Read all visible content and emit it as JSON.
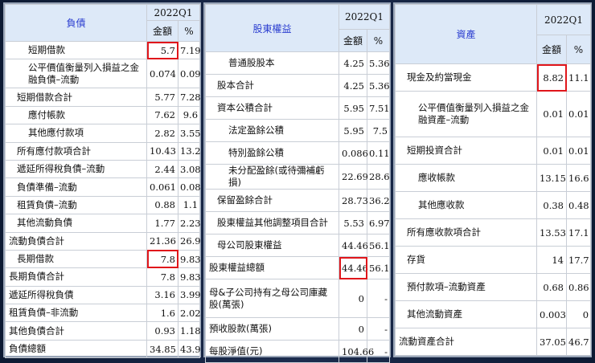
{
  "panels": [
    {
      "title": "負債",
      "period": "2022Q1",
      "amount_header": "金額",
      "pct_header": "%",
      "rows": [
        {
          "label": "短期借款",
          "amount": "5.7",
          "pct": "7.19",
          "level": 2,
          "highlight": true
        },
        {
          "label": "公平價值衡量列入損益之金融負債–流動",
          "amount": "0.074",
          "pct": "0.09",
          "level": 2
        },
        {
          "label": "短期借款合計",
          "amount": "5.77",
          "pct": "7.28",
          "level": 1
        },
        {
          "label": "應付帳款",
          "amount": "7.62",
          "pct": "9.6",
          "level": 2
        },
        {
          "label": "其他應付款項",
          "amount": "2.82",
          "pct": "3.55",
          "level": 2
        },
        {
          "label": "所有應付款項合計",
          "amount": "10.43",
          "pct": "13.2",
          "level": 1
        },
        {
          "label": "遞延所得稅負債–流動",
          "amount": "2.44",
          "pct": "3.08",
          "level": 1
        },
        {
          "label": "負債準備–流動",
          "amount": "0.061",
          "pct": "0.08",
          "level": 1
        },
        {
          "label": "租賃負債–流動",
          "amount": "0.88",
          "pct": "1.1",
          "level": 1
        },
        {
          "label": "其他流動負債",
          "amount": "1.77",
          "pct": "2.23",
          "level": 1
        },
        {
          "label": "流動負債合計",
          "amount": "21.36",
          "pct": "26.9",
          "level": 0
        },
        {
          "label": "長期借款",
          "amount": "7.8",
          "pct": "9.83",
          "level": 1,
          "highlight": true
        },
        {
          "label": "長期負債合計",
          "amount": "7.8",
          "pct": "9.83",
          "level": 0
        },
        {
          "label": "遞延所得稅負債",
          "amount": "3.16",
          "pct": "3.99",
          "level": 0
        },
        {
          "label": "租賃負債–非流動",
          "amount": "1.6",
          "pct": "2.02",
          "level": 0
        },
        {
          "label": "其他負債合計",
          "amount": "0.93",
          "pct": "1.18",
          "level": 0
        },
        {
          "label": "負債總額",
          "amount": "34.85",
          "pct": "43.9",
          "level": -1
        }
      ]
    },
    {
      "title": "股東權益",
      "period": "2022Q1",
      "amount_header": "金額",
      "pct_header": "%",
      "rows": [
        {
          "label": "普通股股本",
          "amount": "4.25",
          "pct": "5.36",
          "level": 2
        },
        {
          "label": "股本合計",
          "amount": "4.25",
          "pct": "5.36",
          "level": 1
        },
        {
          "label": "資本公積合計",
          "amount": "5.95",
          "pct": "7.51",
          "level": 1
        },
        {
          "label": "法定盈餘公積",
          "amount": "5.95",
          "pct": "7.5",
          "level": 2
        },
        {
          "label": "特別盈餘公積",
          "amount": "0.086",
          "pct": "0.11",
          "level": 2
        },
        {
          "label": "未分配盈餘(或待彌補虧損)",
          "amount": "22.69",
          "pct": "28.6",
          "level": 2
        },
        {
          "label": "保留盈餘合計",
          "amount": "28.73",
          "pct": "36.2",
          "level": 1
        },
        {
          "label": "股東權益其他調整項目合計",
          "amount": "5.53",
          "pct": "6.97",
          "level": 1
        },
        {
          "label": "母公司股東權益",
          "amount": "44.46",
          "pct": "56.1",
          "level": 1
        },
        {
          "label": "股東權益總額",
          "amount": "44.46",
          "pct": "56.1",
          "level": 0,
          "highlight": true
        },
        {
          "label": "母&子公司持有之母公司庫藏股(萬張)",
          "amount": "0",
          "pct": "-",
          "level": 0
        },
        {
          "label": "預收股款(萬張)",
          "amount": "0",
          "pct": "-",
          "level": 0
        },
        {
          "label": "每股淨值(元)",
          "amount": "104.66",
          "pct": "-",
          "level": 0
        }
      ]
    },
    {
      "title": "資產",
      "period": "2022Q1",
      "amount_header": "金額",
      "pct_header": "%",
      "rows": [
        {
          "label": "現金及約當現金",
          "amount": "8.82",
          "pct": "11.1",
          "level": 1,
          "highlight": true
        },
        {
          "label": "公平價值衡量列入損益之金融資產–流動",
          "amount": "0.01",
          "pct": "0.01",
          "level": 2
        },
        {
          "label": "短期投資合計",
          "amount": "0.01",
          "pct": "0.01",
          "level": 1
        },
        {
          "label": "應收帳款",
          "amount": "13.15",
          "pct": "16.6",
          "level": 2
        },
        {
          "label": "其他應收款",
          "amount": "0.38",
          "pct": "0.48",
          "level": 2
        },
        {
          "label": "所有應收款項合計",
          "amount": "13.53",
          "pct": "17.1",
          "level": 1
        },
        {
          "label": "存貨",
          "amount": "14",
          "pct": "17.7",
          "level": 1
        },
        {
          "label": "預付款項–流動資產",
          "amount": "0.68",
          "pct": "0.86",
          "level": 1
        },
        {
          "label": "其他流動資產",
          "amount": "0.003",
          "pct": "0",
          "level": 1
        },
        {
          "label": "流動資產合計",
          "amount": "37.05",
          "pct": "46.7",
          "level": 0
        }
      ]
    }
  ]
}
